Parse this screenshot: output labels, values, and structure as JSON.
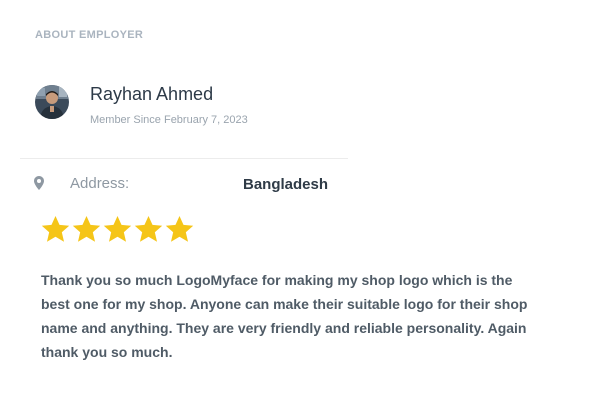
{
  "section": {
    "title": "ABOUT EMPLOYER"
  },
  "employer": {
    "name": "Rayhan Ahmed",
    "member_since": "Member Since February 7, 2023",
    "avatar_icon": "user-avatar"
  },
  "address": {
    "icon": "map-pin-icon",
    "label": "Address:",
    "value": "Bangladesh"
  },
  "rating": {
    "stars": 5,
    "max": 5,
    "color": "#f5c518"
  },
  "review": {
    "text": "Thank you so much LogoMyface for making my shop logo which is the best one for my shop. Anyone can make their suitable logo for their shop name and anything. They are very friendly and reliable personality. Again thank you so much."
  },
  "colors": {
    "title": "#aab4bf",
    "name": "#2d3a48",
    "muted": "#9aa4ae",
    "body_text": "#4f5b66",
    "star": "#f5c518"
  }
}
